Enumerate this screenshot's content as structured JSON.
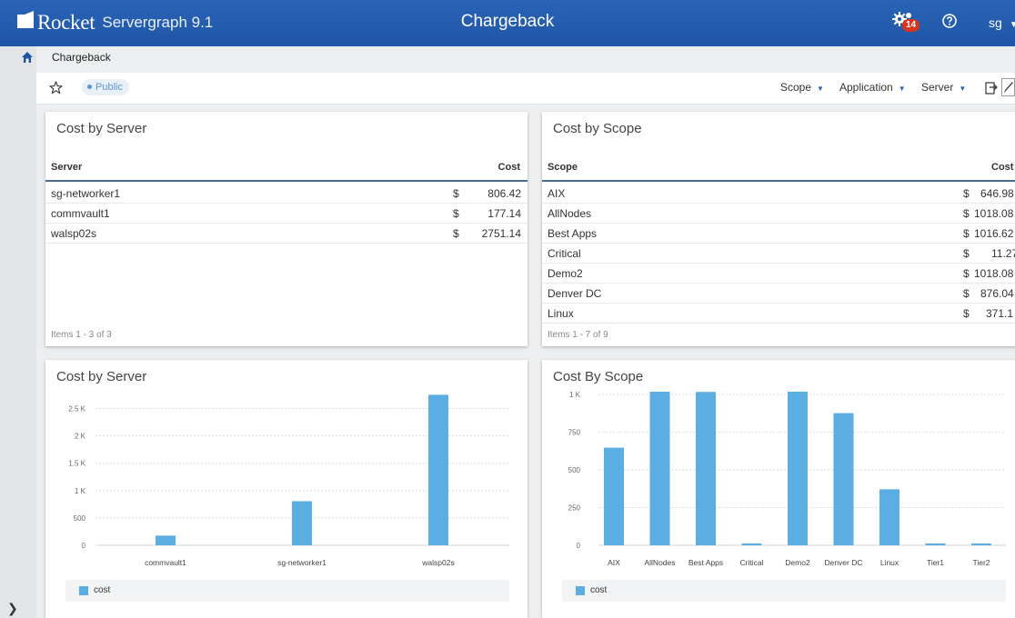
{
  "header": {
    "brand": "Rocket",
    "product": "Servergraph 9.1",
    "title": "Chargeback",
    "notification_count": "14",
    "user": "sg"
  },
  "breadcrumb": {
    "current": "Chargeback"
  },
  "toolbar": {
    "visibility_badge": "Public",
    "filters": [
      "Scope",
      "Application",
      "Server"
    ]
  },
  "server_table": {
    "title": "Cost by Server",
    "col_server": "Server",
    "col_cost": "Cost",
    "rows": [
      {
        "name": "sg-networker1",
        "currency": "$",
        "cost": "806.42"
      },
      {
        "name": "commvault1",
        "currency": "$",
        "cost": "177.14"
      },
      {
        "name": "walsp02s",
        "currency": "$",
        "cost": "2751.14"
      }
    ],
    "footer": "Items 1 - 3 of 3"
  },
  "scope_table": {
    "title": "Cost by Scope",
    "col_scope": "Scope",
    "col_cost": "Cost",
    "rows": [
      {
        "name": "AIX",
        "currency": "$",
        "cost": "646.98"
      },
      {
        "name": "AllNodes",
        "currency": "$",
        "cost": "1018.08"
      },
      {
        "name": "Best Apps",
        "currency": "$",
        "cost": "1016.62"
      },
      {
        "name": "Critical",
        "currency": "$",
        "cost": "11.27"
      },
      {
        "name": "Demo2",
        "currency": "$",
        "cost": "1018.08"
      },
      {
        "name": "Denver DC",
        "currency": "$",
        "cost": "876.04"
      },
      {
        "name": "Linux",
        "currency": "$",
        "cost": "371.1"
      }
    ],
    "footer": "Items 1 - 7 of 9"
  },
  "colors": {
    "bar": "#5aaee2",
    "header": "#1f55a7",
    "badge": "#d9341f"
  },
  "chart_data": [
    {
      "type": "bar",
      "title": "Cost by Server",
      "categories": [
        "commvault1",
        "sg-networker1",
        "walsp02s"
      ],
      "series": [
        {
          "name": "cost",
          "values": [
            177.14,
            806.42,
            2751.14
          ]
        }
      ],
      "ylim": [
        0,
        2750
      ],
      "yticks": [
        0,
        500,
        1000,
        1500,
        2000,
        2500
      ],
      "ytick_labels": [
        "0",
        "500",
        "1 K",
        "1.5 K",
        "2 K",
        "2.5 K"
      ],
      "grid": true,
      "legend": "bottom"
    },
    {
      "type": "bar",
      "title": "Cost By Scope",
      "categories": [
        "AIX",
        "AllNodes",
        "Best Apps",
        "Critical",
        "Demo2",
        "Denver DC",
        "Linux",
        "Tier1",
        "Tier2"
      ],
      "series": [
        {
          "name": "cost",
          "values": [
            646.98,
            1018.08,
            1016.62,
            11.27,
            1018.08,
            876.04,
            371.1,
            11,
            11
          ]
        }
      ],
      "ylim": [
        0,
        1000
      ],
      "yticks": [
        0,
        250,
        500,
        750,
        1000
      ],
      "ytick_labels": [
        "0",
        "250",
        "500",
        "750",
        "1 K"
      ],
      "grid": true,
      "legend": "bottom"
    }
  ]
}
